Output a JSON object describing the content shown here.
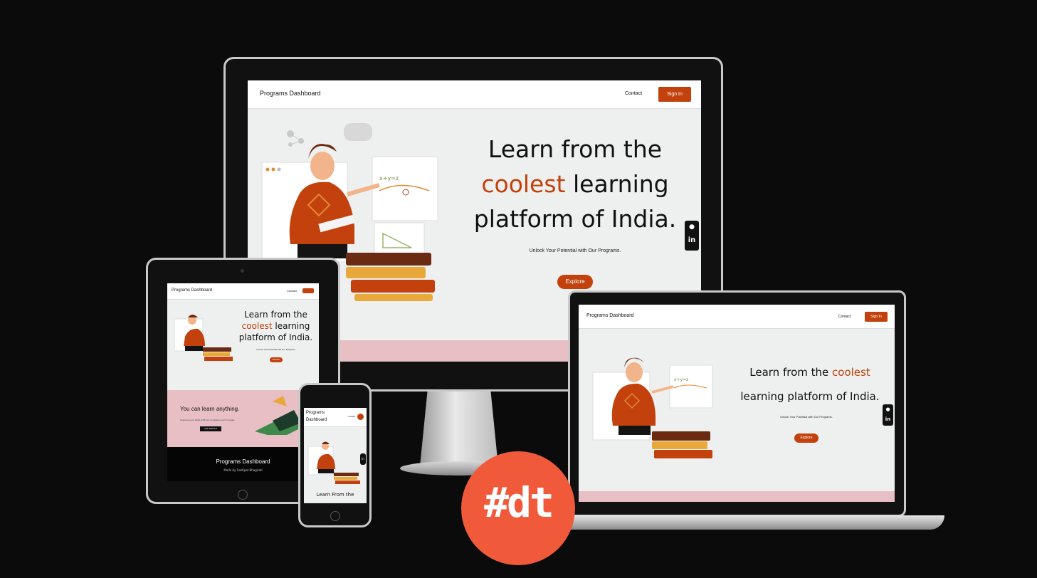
{
  "desktop": {
    "brand": "Programs Dashboard",
    "nav_contact": "Contact",
    "nav_signin": "Sign In",
    "hero_line1": "Learn from the",
    "hero_accent": "coolest",
    "hero_line2_rest": " learning",
    "hero_line3": "platform of India.",
    "subtitle": "Unlock Your Potential with Our Programs.",
    "cta": "Explore",
    "social_github": "github-icon",
    "social_linkedin": "in"
  },
  "laptop": {
    "brand": "Programs Dashboard",
    "nav_contact": "Contact",
    "nav_signin": "Sign In",
    "hero_line1_a": "Learn from the ",
    "hero_accent": "coolest",
    "hero_line2": "learning platform of India.",
    "subtitle": "Unlock Your Potential with Our Programs.",
    "cta": "Explore",
    "social_linkedin": "in"
  },
  "tablet": {
    "brand": "Programs Dashboard",
    "nav_contact": "Contact",
    "hero_line1": "Learn from the",
    "hero_accent": "coolest",
    "hero_line2_rest": " learning",
    "hero_line3": "platform of India.",
    "subtitle": "Unlock Your Potential with Our Programs.",
    "cta": "Explore",
    "section_title": "You can learn anything.",
    "section_text": "Improve your skills with our programs and courses.",
    "section_btn": "Get Started",
    "footer_title": "Programs Dashboard",
    "footer_sub": "Made by Saktipat Bhagirati"
  },
  "phone": {
    "brand_l1": "Programs",
    "brand_l2": "Dashboard",
    "nav_contact": "Contact",
    "hero_line1": "Learn From the",
    "social_linkedin": "in"
  },
  "badge": {
    "text": "#dt",
    "color": "#f05a3a"
  },
  "colors": {
    "accent": "#c2410c",
    "pink": "#e8bfc4"
  }
}
